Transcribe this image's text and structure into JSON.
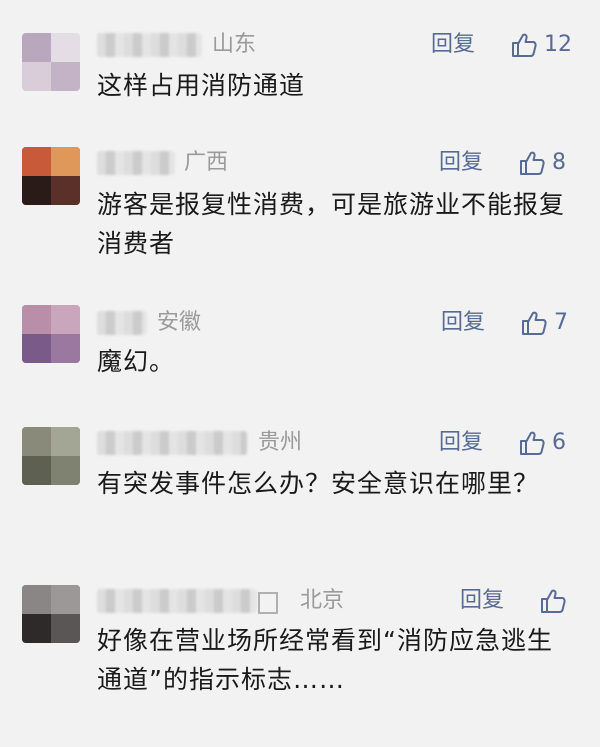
{
  "comments": [
    {
      "location": "山东",
      "reply": "回复",
      "likes": "12",
      "text": "这样占用消防通道"
    },
    {
      "location": "广西",
      "reply": "回复",
      "likes": "8",
      "text": "游客是报复性消费，可是旅游业不能报复消费者"
    },
    {
      "location": "安徽",
      "reply": "回复",
      "likes": "7",
      "text": "魔幻。"
    },
    {
      "location": "贵州",
      "reply": "回复",
      "likes": "6",
      "text": "有突发事件怎么办？安全意识在哪里？"
    },
    {
      "location": "北京",
      "reply": "回复",
      "likes": "",
      "text": "好像在营业场所经常看到“消防应急逃生通道”的指示标志……"
    }
  ],
  "colors": {
    "link": "#576b95",
    "location": "#9a9a9a",
    "background": "#f2f2f2",
    "text": "#1a1a1a"
  },
  "icons": {
    "like": "thumbs-up-icon",
    "avatar": "pixelated-avatar"
  }
}
